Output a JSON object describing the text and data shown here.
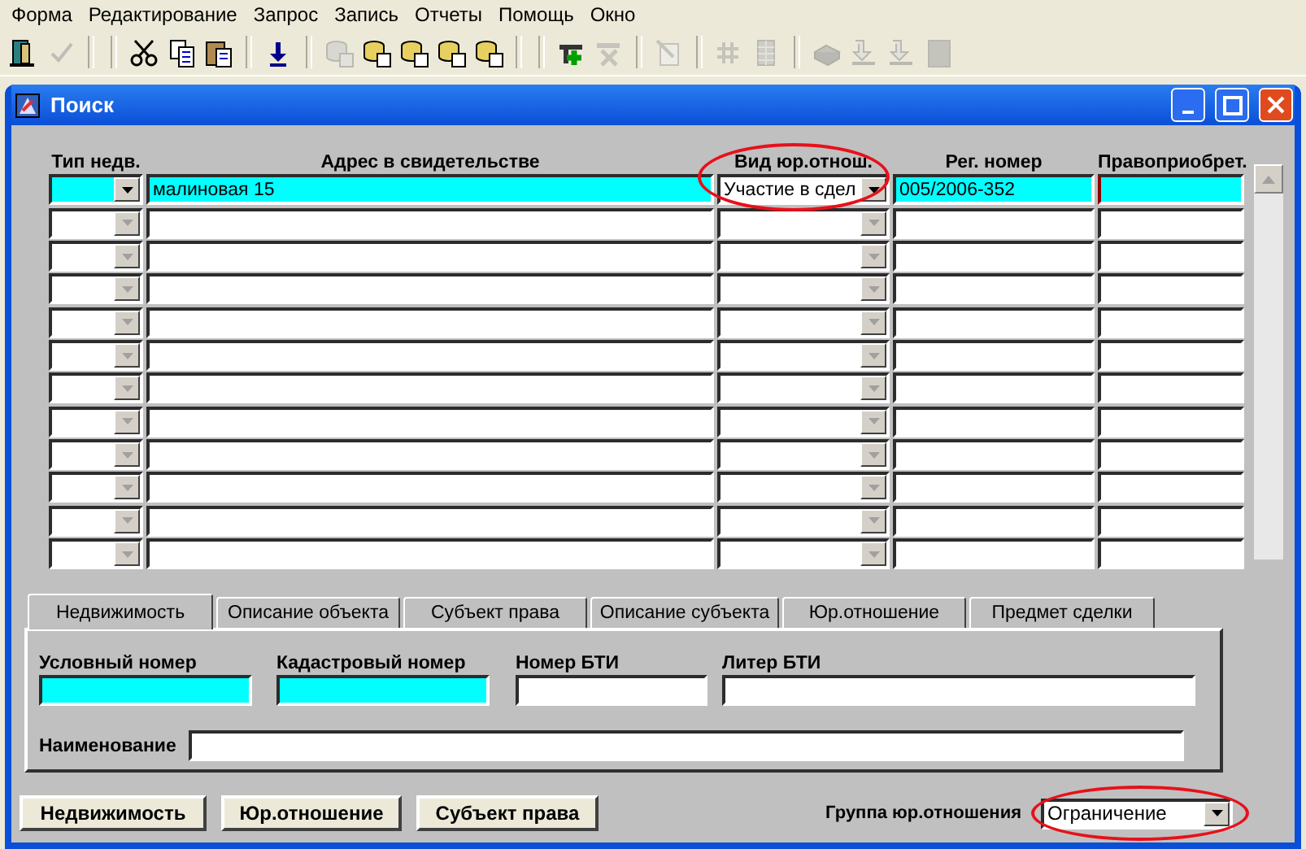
{
  "menu": [
    "Форма",
    "Редактирование",
    "Запрос",
    "Запись",
    "Отчеты",
    "Помощь",
    "Окно"
  ],
  "toolbar": [
    {
      "kind": "exit",
      "disabled": false
    },
    {
      "kind": "check",
      "disabled": true
    },
    {
      "kind": "sep"
    },
    {
      "kind": "sep"
    },
    {
      "kind": "cut",
      "disabled": false
    },
    {
      "kind": "copy",
      "disabled": false
    },
    {
      "kind": "paste",
      "disabled": false
    },
    {
      "kind": "sep"
    },
    {
      "kind": "download",
      "disabled": false
    },
    {
      "kind": "sep"
    },
    {
      "kind": "db",
      "disabled": true
    },
    {
      "kind": "db",
      "disabled": false
    },
    {
      "kind": "db",
      "disabled": false
    },
    {
      "kind": "db",
      "disabled": false
    },
    {
      "kind": "db",
      "disabled": false
    },
    {
      "kind": "sep"
    },
    {
      "kind": "sep"
    },
    {
      "kind": "add",
      "disabled": false
    },
    {
      "kind": "delete",
      "disabled": true
    },
    {
      "kind": "sep"
    },
    {
      "kind": "edit",
      "disabled": true
    },
    {
      "kind": "sep"
    },
    {
      "kind": "hash",
      "disabled": true
    },
    {
      "kind": "grid",
      "disabled": true
    },
    {
      "kind": "sep"
    },
    {
      "kind": "print",
      "disabled": true
    },
    {
      "kind": "arrow",
      "disabled": true
    },
    {
      "kind": "arrow",
      "disabled": true
    },
    {
      "kind": "square",
      "disabled": true
    }
  ],
  "window": {
    "title": "Поиск"
  },
  "table": {
    "columns": [
      {
        "label": "Тип недв."
      },
      {
        "label": "Адрес в свидетельстве"
      },
      {
        "label": "Вид юр.отнош.",
        "highlighted": true
      },
      {
        "label": "Рег. номер"
      },
      {
        "label": "Правоприобрет."
      }
    ],
    "rows": [
      {
        "current": true,
        "address": "малиновая 15",
        "legal_type": "Участие в сдел",
        "reg_number": "005/2006-352"
      },
      {
        "current": false
      },
      {
        "current": false
      },
      {
        "current": false
      },
      {
        "current": false
      },
      {
        "current": false
      },
      {
        "current": false
      },
      {
        "current": false
      },
      {
        "current": false
      },
      {
        "current": false
      },
      {
        "current": false
      },
      {
        "current": false
      }
    ]
  },
  "tabs": [
    {
      "label": "Недвижимость",
      "selected": true
    },
    {
      "label": "Описание объекта",
      "selected": false
    },
    {
      "label": "Субъект права",
      "selected": false
    },
    {
      "label": "Описание субъекта",
      "selected": false
    },
    {
      "label": "Юр.отношение",
      "selected": false
    },
    {
      "label": "Предмет сделки",
      "selected": false
    }
  ],
  "fields": [
    {
      "label": "Условный номер",
      "required": true
    },
    {
      "label": "Кадастровый номер",
      "required": true
    },
    {
      "label": "Номер БТИ",
      "required": false
    },
    {
      "label": "Литер БТИ",
      "required": false
    },
    {
      "label": "Наименование",
      "required": false
    }
  ],
  "buttons": [
    "Недвижимость",
    "Юр.отношение",
    "Субъект права"
  ],
  "group_field": {
    "label": "Группа юр.отношения",
    "value": "Ограничение",
    "highlighted": true
  }
}
